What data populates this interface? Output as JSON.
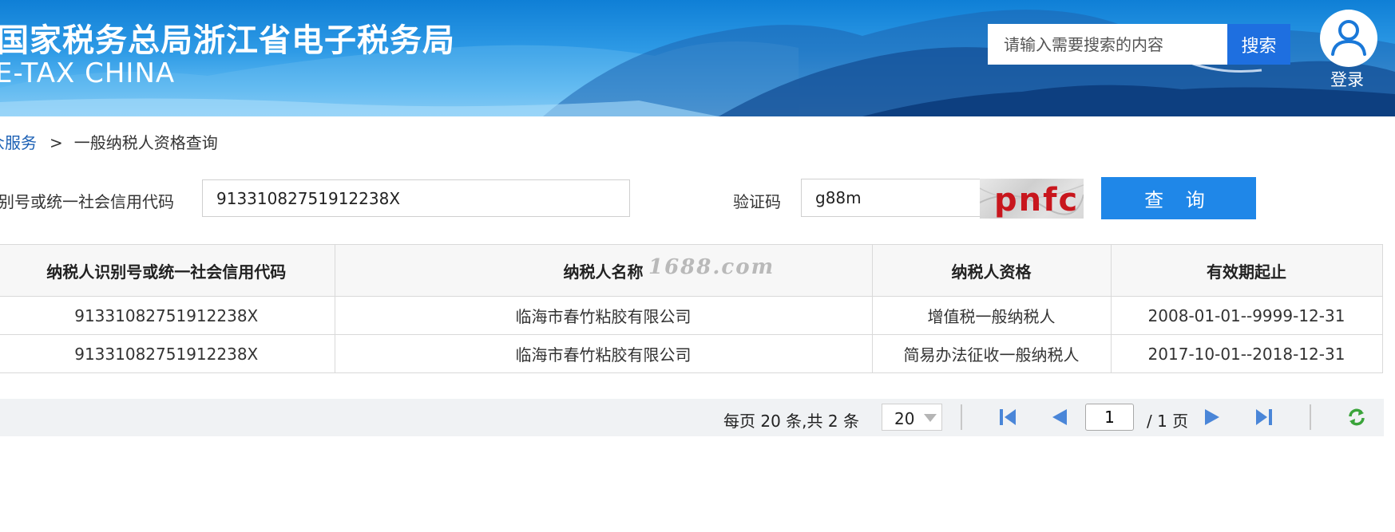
{
  "header": {
    "title": "国家税务总局浙江省电子税务局",
    "subtitle": "E-TAX CHINA",
    "search_placeholder": "请输入需要搜索的内容",
    "search_button": "搜索",
    "login_label": "登录"
  },
  "breadcrumb": {
    "parent": "众服务",
    "separator": ">",
    "current": "一般纳税人资格查询"
  },
  "query_form": {
    "taxpayer_id_label": "别号或统一社会信用代码",
    "taxpayer_id_value": "91331082751912238X",
    "captcha_label": "验证码",
    "captcha_value": "g88m",
    "captcha_image_text": "pnfc",
    "query_button": "查 询"
  },
  "results_table": {
    "columns": [
      "纳税人识别号或统一社会信用代码",
      "纳税人名称",
      "纳税人资格",
      "有效期起止"
    ],
    "rows": [
      [
        "91331082751912238X",
        "临海市春竹粘胶有限公司",
        "增值税一般纳税人",
        "2008-01-01--9999-12-31"
      ],
      [
        "91331082751912238X",
        "临海市春竹粘胶有限公司",
        "简易办法征收一般纳税人",
        "2017-10-01--2018-12-31"
      ]
    ]
  },
  "watermark": "1688.com",
  "pagination": {
    "summary": "每页 20 条,共 2 条",
    "page_size": "20",
    "current_page": "1",
    "total_pages_label": "/ 1 页"
  },
  "colors": {
    "search_button": "#1e6fe0",
    "query_button": "#1f87e8",
    "link": "#1a5fb4",
    "captcha_text": "#c8161d"
  },
  "icons": {
    "first_page": "first-page-icon",
    "prev_page": "prev-page-icon",
    "next_page": "next-page-icon",
    "last_page": "last-page-icon",
    "refresh": "refresh-icon",
    "user": "user-icon"
  }
}
